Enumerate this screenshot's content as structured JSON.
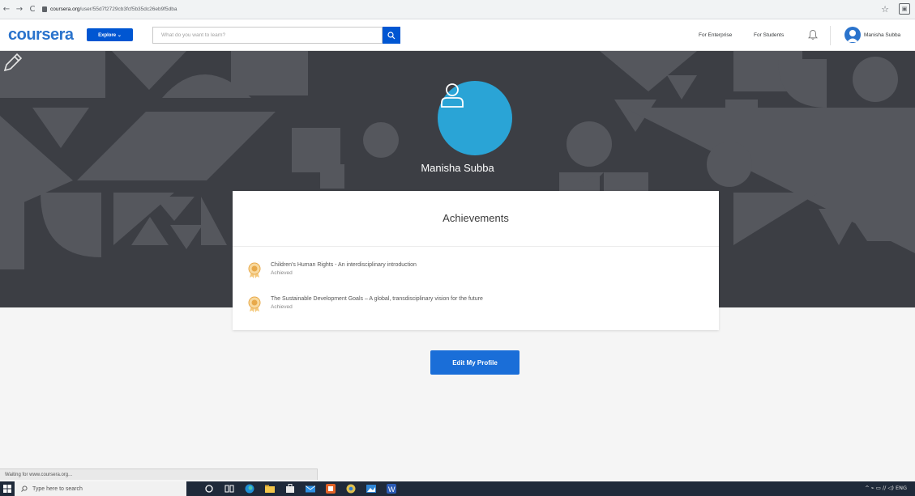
{
  "browser": {
    "back": "←",
    "forward": "→",
    "reload": "C",
    "url_host": "coursera.org",
    "url_path": "/user/55d7f2729cb3fcf5b35dc26eb9f5dba",
    "star": "☆",
    "ext": "▣"
  },
  "header": {
    "logo": "coursera",
    "explore_label": "Explore ⌄",
    "search_placeholder": "What do you want to learn?",
    "for_enterprise": "For Enterprise",
    "for_students": "For Students",
    "user_name": "Manisha Subba"
  },
  "profile": {
    "name": "Manisha Subba"
  },
  "achievements": {
    "title": "Achievements",
    "items": [
      {
        "title": "Children's Human Rights - An interdisciplinary introduction",
        "status": "Achieved"
      },
      {
        "title": "The Sustainable Development Goals – A global, transdisciplinary vision for the future",
        "status": "Achieved"
      }
    ]
  },
  "edit_profile_label": "Edit My Profile",
  "status_tip": "Waiting for www.coursera.org...",
  "taskbar": {
    "search_placeholder": "Type here to search",
    "tray_text": "^  ⌁  ▭  ∕∕  ◁)  ENG"
  },
  "colors": {
    "brand": "#2a73cc",
    "primary_button": "#0056d2",
    "banner_bg": "#3c3e44",
    "avatar_bg": "#2aa4d6"
  }
}
